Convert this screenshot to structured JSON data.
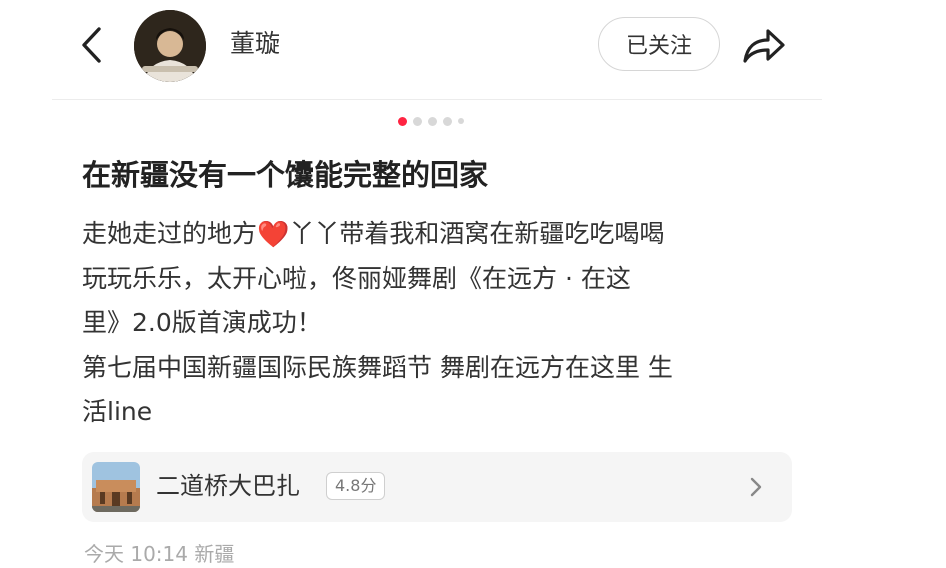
{
  "header": {
    "back_icon": "chevron-left-icon",
    "author_name": "董璇",
    "follow_label": "已关注",
    "share_icon": "share-arrow-icon"
  },
  "carousel": {
    "total_dots": 5,
    "active_index": 0,
    "active_color": "#ff2442"
  },
  "note": {
    "title": "在新疆没有一个馕能完整的回家",
    "desc_lines": [
      {
        "before": "走她走过的地方",
        "emoji": "❤️",
        "after": "丫丫带着我和酒窝在新疆吃吃喝喝"
      },
      {
        "text": "玩玩乐乐，太开心啦，佟丽娅舞剧《在远方 · 在这"
      },
      {
        "text": "里》2.0版首演成功！"
      },
      {
        "text": "第七届中国新疆国际民族舞蹈节 舞剧在远方在这里 生"
      },
      {
        "text": "活line"
      }
    ]
  },
  "poi": {
    "name": "二道桥大巴扎",
    "rating": "4.8分",
    "chevron_icon": "chevron-right-icon"
  },
  "footer": {
    "meta": "今天 10:14 新疆"
  }
}
